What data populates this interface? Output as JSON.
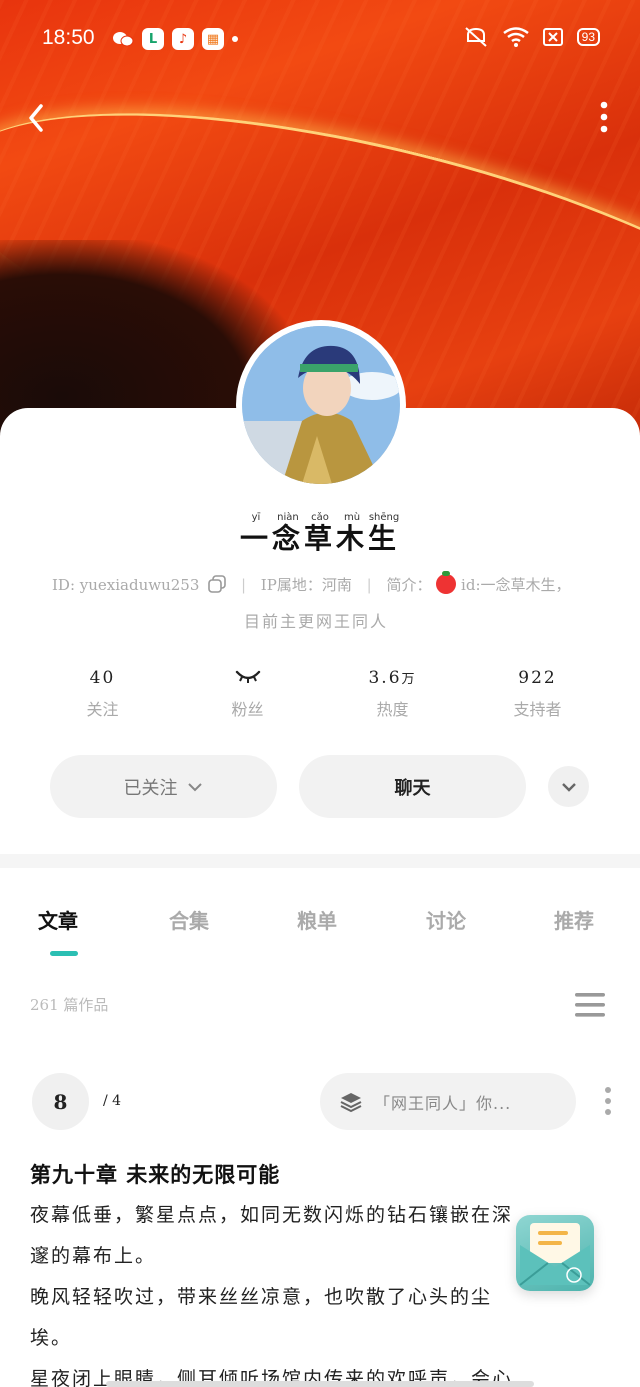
{
  "status": {
    "time": "18:50",
    "battery": "93"
  },
  "profile": {
    "name": "一念草木生",
    "name_pinyin": [
      "yī",
      "niàn",
      "cǎo",
      "mù",
      "shēng"
    ],
    "id_label": "ID: yuexiaduwu253",
    "ip_label": "IP属地：",
    "ip_value": "河南",
    "bio_label": "简介：",
    "bio_line1": "id:一念草木生，",
    "bio_line2": "目前主更网王同人"
  },
  "stats": [
    {
      "value": "40",
      "label": "关注"
    },
    {
      "value": "",
      "label": "粉丝"
    },
    {
      "value": "3.6",
      "unit": "万",
      "label": "热度"
    },
    {
      "value": "922",
      "label": "支持者"
    }
  ],
  "buttons": {
    "follow": "已关注",
    "chat": "聊天"
  },
  "tabs": [
    "文章",
    "合集",
    "粮单",
    "讨论",
    "推荐"
  ],
  "works": {
    "count": "261",
    "unit": "篇作品"
  },
  "pager": {
    "current": "8",
    "total": "/ 4"
  },
  "filter": {
    "text": "「网王同人」你..."
  },
  "article": {
    "title": "第九十章 未来的无限可能",
    "lines": [
      "夜幕低垂，繁星点点，如同无数闪烁的钻石镶嵌在深",
      "邃的幕布上。",
      "晚风轻轻吹过，带来丝丝凉意，也吹散了心头的尘",
      "埃。",
      "星夜闭上眼睛，侧耳倾听场馆内传来的欢呼声，会心"
    ]
  },
  "colors": {
    "accent": "#2bbfb3",
    "hero": "#e8340e"
  }
}
